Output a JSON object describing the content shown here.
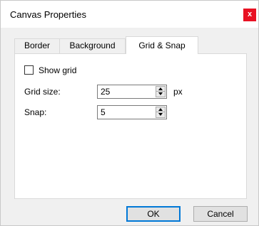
{
  "window": {
    "title": "Canvas Properties",
    "close_label": "x",
    "close_color": "#e81123"
  },
  "tabs": [
    {
      "label": "Border",
      "active": false
    },
    {
      "label": "Background",
      "active": false
    },
    {
      "label": "Grid & Snap",
      "active": true
    }
  ],
  "grid_snap": {
    "show_grid": {
      "label": "Show grid",
      "checked": false
    },
    "grid_size": {
      "label": "Grid size:",
      "value": "25",
      "unit": "px"
    },
    "snap": {
      "label": "Snap:",
      "value": "5"
    }
  },
  "buttons": {
    "ok_label": "OK",
    "cancel_label": "Cancel"
  },
  "colors": {
    "accent": "#0078d7"
  }
}
